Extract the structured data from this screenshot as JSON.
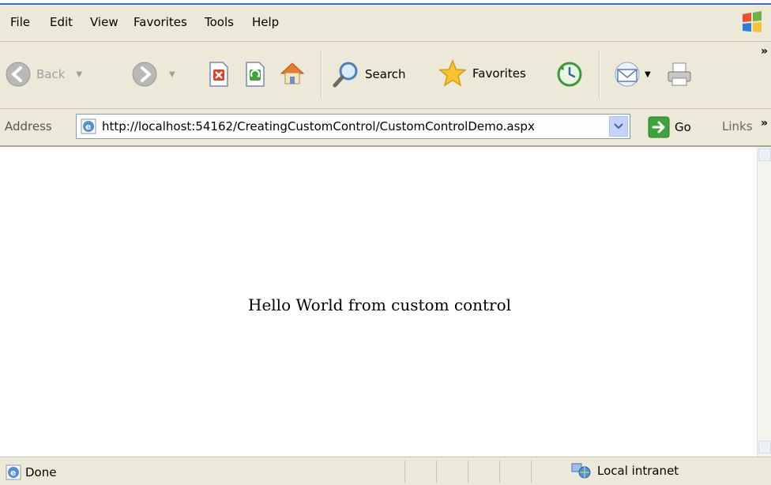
{
  "menu": {
    "items": [
      {
        "label": "File"
      },
      {
        "label": "Edit"
      },
      {
        "label": "View"
      },
      {
        "label": "Favorites"
      },
      {
        "label": "Tools"
      },
      {
        "label": "Help"
      }
    ]
  },
  "toolbar": {
    "back_label": "Back",
    "search_label": "Search",
    "favorites_label": "Favorites"
  },
  "address": {
    "label": "Address",
    "url": "http://localhost:54162/CreatingCustomControl/CustomControlDemo.aspx",
    "go_label": "Go",
    "links_label": "Links"
  },
  "page": {
    "text": "Hello World from custom control"
  },
  "status": {
    "text": "Done",
    "zone": "Local intranet"
  }
}
